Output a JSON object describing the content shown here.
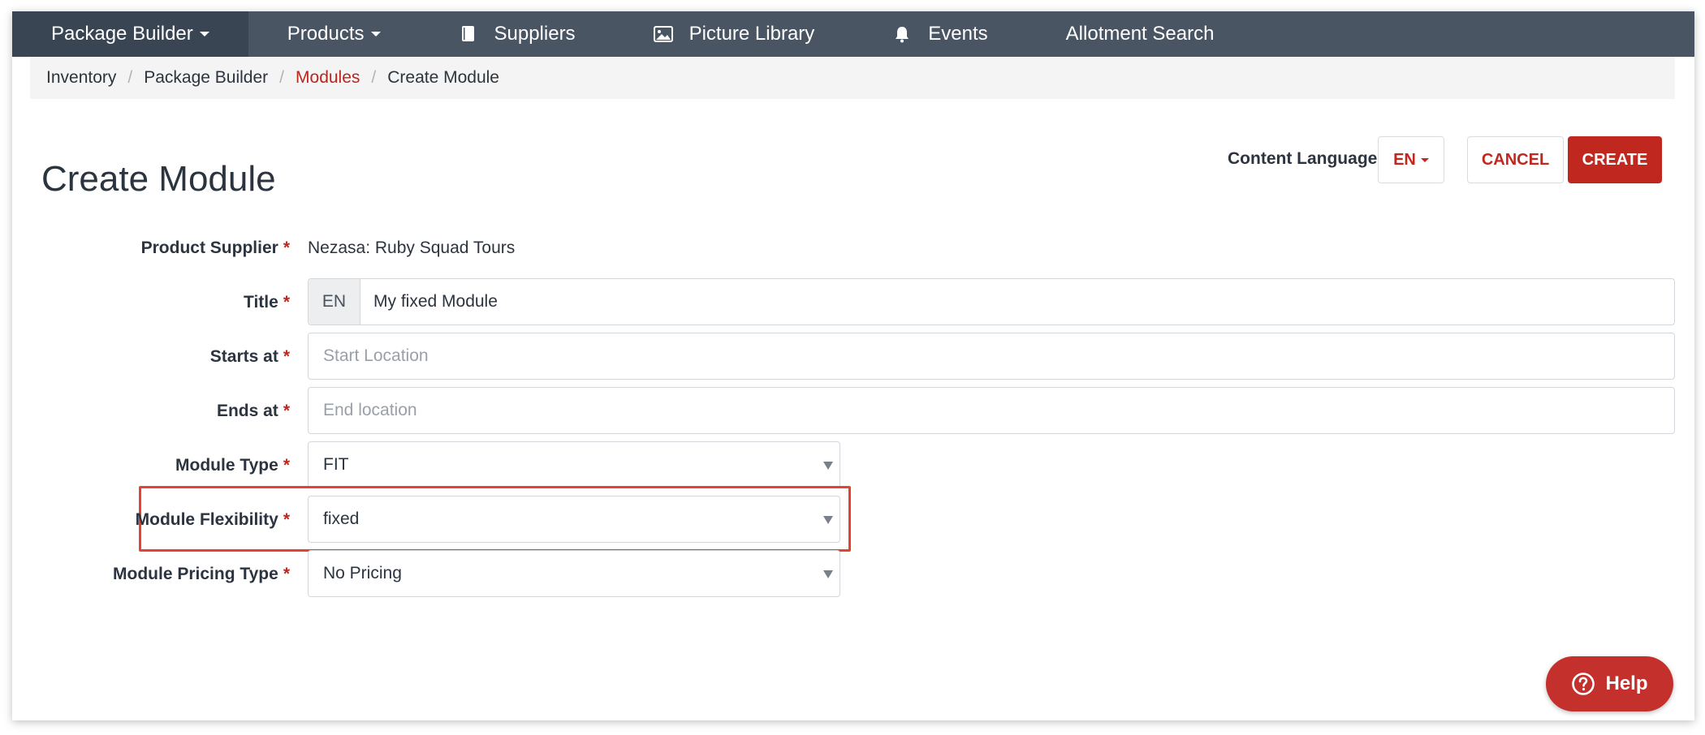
{
  "topnav": {
    "items": [
      {
        "label": "Package Builder",
        "icon": "",
        "dropdown": true
      },
      {
        "label": "Products",
        "icon": "",
        "dropdown": true
      },
      {
        "label": "Suppliers",
        "icon": "book-icon",
        "dropdown": false
      },
      {
        "label": "Picture Library",
        "icon": "picture-icon",
        "dropdown": false
      },
      {
        "label": "Events",
        "icon": "bell-icon",
        "dropdown": false
      },
      {
        "label": "Allotment Search",
        "icon": "",
        "dropdown": false
      }
    ]
  },
  "breadcrumb": [
    "Inventory",
    "Package Builder",
    "Modules",
    "Create Module"
  ],
  "page": {
    "title": "Create Module",
    "content_language_label": "Content Language",
    "language": "EN",
    "cancel_label": "CANCEL",
    "create_label": "CREATE"
  },
  "form": {
    "required_marker": "*",
    "product_supplier": {
      "label": "Product Supplier",
      "value": "Nezasa: Ruby Squad Tours"
    },
    "title": {
      "label": "Title",
      "language": "EN",
      "value": "My fixed Module"
    },
    "starts_at": {
      "label": "Starts at",
      "placeholder": "Start Location"
    },
    "ends_at": {
      "label": "Ends at",
      "placeholder": "End location"
    },
    "module_type": {
      "label": "Module Type",
      "value": "FIT"
    },
    "module_flexibility": {
      "label": "Module Flexibility",
      "value": "fixed"
    },
    "module_pricing_type": {
      "label": "Module Pricing Type",
      "value": "No Pricing"
    }
  },
  "help": {
    "label": "Help"
  },
  "colors": {
    "nav_bg": "#4a5564",
    "accent_red": "#c0281f",
    "highlight": "#e2442f"
  }
}
